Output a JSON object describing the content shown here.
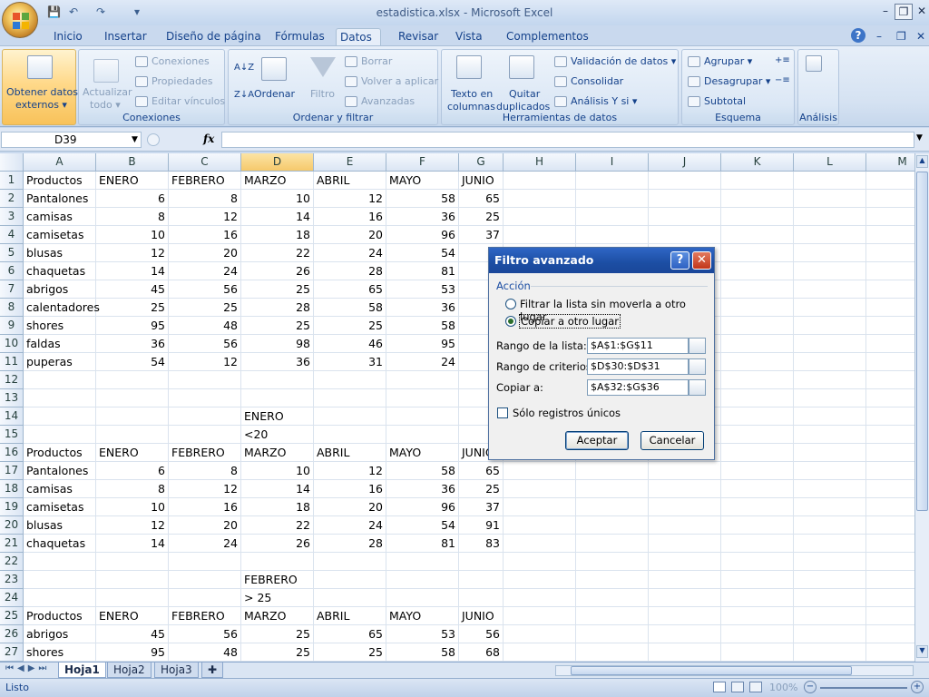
{
  "window": {
    "title": "estadistica.xlsx - Microsoft Excel",
    "minimize": "–",
    "restore": "❐",
    "close": "✕",
    "doc_minimize": "–",
    "doc_restore": "❐",
    "doc_close": "✕"
  },
  "qat": {
    "save": "💾",
    "undo": "↶",
    "redo": "↷",
    "customize": "▾"
  },
  "tabs": [
    "Inicio",
    "Insertar",
    "Diseño de página",
    "Fórmulas",
    "Datos",
    "Revisar",
    "Vista",
    "Complementos"
  ],
  "help": "?",
  "ribbon": {
    "obtener": {
      "label1": "Obtener datos",
      "label2": "externos ▾"
    },
    "actualizar": {
      "label1": "Actualizar",
      "label2": "todo ▾"
    },
    "conexiones": {
      "conexiones": "Conexiones",
      "propiedades": "Propiedades",
      "editar": "Editar vínculos",
      "group": "Conexiones"
    },
    "ordenar": {
      "ordenar": "Ordenar",
      "filtro": "Filtro",
      "borrar": "Borrar",
      "volver": "Volver a aplicar",
      "avanzadas": "Avanzadas",
      "group": "Ordenar y filtrar"
    },
    "herramientas": {
      "texto1": "Texto en",
      "texto2": "columnas",
      "quitar1": "Quitar",
      "quitar2": "duplicados",
      "validacion": "Validación de datos ▾",
      "consolidar": "Consolidar",
      "analisis": "Análisis Y si ▾",
      "group": "Herramientas de datos"
    },
    "esquema": {
      "agrupar": "Agrupar ▾",
      "desagrupar": "Desagrupar ▾",
      "subtotal": "Subtotal",
      "group": "Esquema"
    },
    "analisis": {
      "group": "Análisis"
    }
  },
  "formula_bar": {
    "name_box": "D39",
    "fx": "fx",
    "value": ""
  },
  "columns": [
    "A",
    "B",
    "C",
    "D",
    "E",
    "F",
    "G",
    "H",
    "I",
    "J",
    "K",
    "L",
    "M"
  ],
  "rows": [
    [
      "Productos",
      "ENERO",
      "FEBRERO",
      "MARZO",
      "ABRIL",
      "MAYO",
      "JUNIO"
    ],
    [
      "Pantalones",
      "6",
      "8",
      "10",
      "12",
      "58",
      "65"
    ],
    [
      "camisas",
      "8",
      "12",
      "14",
      "16",
      "36",
      "25"
    ],
    [
      "camisetas",
      "10",
      "16",
      "18",
      "20",
      "96",
      "37"
    ],
    [
      "blusas",
      "12",
      "20",
      "22",
      "24",
      "54",
      ""
    ],
    [
      "chaquetas",
      "14",
      "24",
      "26",
      "28",
      "81",
      ""
    ],
    [
      "abrigos",
      "45",
      "56",
      "25",
      "65",
      "53",
      ""
    ],
    [
      "calentadores",
      "25",
      "25",
      "28",
      "58",
      "36",
      ""
    ],
    [
      "shores",
      "95",
      "48",
      "25",
      "25",
      "58",
      ""
    ],
    [
      "faldas",
      "36",
      "56",
      "98",
      "46",
      "95",
      ""
    ],
    [
      "puperas",
      "54",
      "12",
      "36",
      "31",
      "24",
      ""
    ],
    [
      "",
      "",
      "",
      "",
      "",
      "",
      ""
    ],
    [
      "",
      "",
      "",
      "",
      "",
      "",
      ""
    ],
    [
      "",
      "",
      "",
      "ENERO",
      "",
      "",
      ""
    ],
    [
      "",
      "",
      "",
      "<20",
      "",
      "",
      ""
    ],
    [
      "Productos",
      "ENERO",
      "FEBRERO",
      "MARZO",
      "ABRIL",
      "MAYO",
      "JUNIO"
    ],
    [
      "Pantalones",
      "6",
      "8",
      "10",
      "12",
      "58",
      "65"
    ],
    [
      "camisas",
      "8",
      "12",
      "14",
      "16",
      "36",
      "25"
    ],
    [
      "camisetas",
      "10",
      "16",
      "18",
      "20",
      "96",
      "37"
    ],
    [
      "blusas",
      "12",
      "20",
      "22",
      "24",
      "54",
      "91"
    ],
    [
      "chaquetas",
      "14",
      "24",
      "26",
      "28",
      "81",
      "83"
    ],
    [
      "",
      "",
      "",
      "",
      "",
      "",
      ""
    ],
    [
      "",
      "",
      "",
      "FEBRERO",
      "",
      "",
      ""
    ],
    [
      "",
      "",
      "",
      "> 25",
      "",
      "",
      ""
    ],
    [
      "Productos",
      "ENERO",
      "FEBRERO",
      "MARZO",
      "ABRIL",
      "MAYO",
      "JUNIO"
    ],
    [
      "abrigos",
      "45",
      "56",
      "25",
      "65",
      "53",
      "56"
    ],
    [
      "shores",
      "95",
      "48",
      "25",
      "25",
      "58",
      "68"
    ]
  ],
  "sheets": [
    "Hoja1",
    "Hoja2",
    "Hoja3"
  ],
  "status": {
    "text": "Listo",
    "zoom": "100%"
  },
  "dialog": {
    "title": "Filtro avanzado",
    "help": "?",
    "close": "✕",
    "section": "Acción",
    "opt1": "Filtrar la lista sin moverla a otro lugar",
    "opt2": "Copiar a otro lugar",
    "rango_lista_label": "Rango de la lista:",
    "rango_lista": "$A$1:$G$11",
    "rango_criterios_label": "Rango de criterios:",
    "rango_criterios": "$D$30:$D$31",
    "copiar_label": "Copiar a:",
    "copiar": "$A$32:$G$36",
    "unicos": "Sólo registros únicos",
    "ok": "Aceptar",
    "cancel": "Cancelar"
  }
}
